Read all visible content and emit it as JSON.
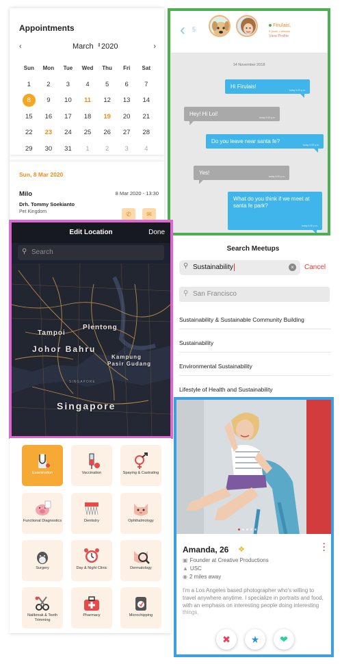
{
  "appointments": {
    "title": "Appointments",
    "month": "March",
    "year": "2020",
    "prev_icon": "chevron-left",
    "next_icon": "chevron-right",
    "weekdays": [
      "Sun",
      "Mon",
      "Tue",
      "Wed",
      "Thu",
      "Fri",
      "Sat"
    ],
    "weeks": [
      [
        "1",
        "2",
        "3",
        "4",
        "5",
        "6",
        "7"
      ],
      [
        "8",
        "9",
        "10",
        "11",
        "12",
        "13",
        "14"
      ],
      [
        "15",
        "16",
        "17",
        "18",
        "19",
        "20",
        "21"
      ],
      [
        "22",
        "23",
        "24",
        "25",
        "26",
        "27",
        "28"
      ],
      [
        "29",
        "30",
        "31",
        "1",
        "2",
        "3",
        "4"
      ]
    ],
    "selected_day": "8",
    "highlighted_days": [
      "11",
      "19",
      "23"
    ],
    "appointment": {
      "date": "Sun, 8 Mar 2020",
      "name": "Milo",
      "time": "8 Mar 2020 - 13:30",
      "doctor": "Drh. Tommy Soekianto",
      "place": "Pet Kingdom"
    },
    "accent_color": "#f5a623"
  },
  "chat": {
    "back_count": "5",
    "contact_name": "Firulais,",
    "contact_sub": "5 years, Labrador",
    "view_profile": "View Profile",
    "date": "14 November 2018",
    "timestamp": "today 9:00 p.m.",
    "messages": [
      {
        "dir": "out",
        "text": "Hi Firulais!"
      },
      {
        "dir": "in",
        "text": "Hey! Hi Loi!"
      },
      {
        "dir": "out",
        "text": "Do you leave near santa fe?"
      },
      {
        "dir": "in",
        "text": "Yes!"
      },
      {
        "dir": "out",
        "text": "What do you think if we meet at santa fe park?"
      }
    ],
    "out_color": "#3fb5ec",
    "in_color": "#a9a9a9"
  },
  "meetups": {
    "title": "Search Meetups",
    "query": "Sustainability",
    "cancel": "Cancel",
    "location": "San Francisco",
    "results": [
      "Sustainability & Sustainable Community Building",
      "Sustainability",
      "Environmental Sustainability",
      "Lifestyle of Health and Sustainability"
    ]
  },
  "map": {
    "title": "Edit Location",
    "done": "Done",
    "search_placeholder": "Search",
    "labels": {
      "tampoi": "Tampoi",
      "plentong": "Plentong",
      "johor_bahru": "Johor Bahru",
      "kampung": "Kampung",
      "pasir_gudang": "Pasir Gudang",
      "singapore_small": "SINGAPORE",
      "singapore": "Singapore"
    }
  },
  "services": {
    "items": [
      {
        "label": "Examination",
        "icon": "stethoscope-icon",
        "active": true
      },
      {
        "label": "Vaccination",
        "icon": "syringe-icon",
        "active": false
      },
      {
        "label": "Spaying & Castrating",
        "icon": "gender-icon",
        "active": false
      },
      {
        "label": "Functional Diagnostics",
        "icon": "pig-icon",
        "active": false
      },
      {
        "label": "Dentistry",
        "icon": "teeth-icon",
        "active": false
      },
      {
        "label": "Ophthalmology",
        "icon": "cat-face-icon",
        "active": false
      },
      {
        "label": "Surgery",
        "icon": "dog-icon",
        "active": false
      },
      {
        "label": "Day & Night Clinic",
        "icon": "alarm-clock-icon",
        "active": false
      },
      {
        "label": "Dermatology",
        "icon": "magnifier-icon",
        "active": false
      },
      {
        "label": "Nailbreak & Teeth Trimming",
        "icon": "scissors-icon",
        "active": false
      },
      {
        "label": "Pharmacy",
        "icon": "medkit-icon",
        "active": false
      },
      {
        "label": "Microchipping",
        "icon": "chip-icon",
        "active": false
      }
    ]
  },
  "profile": {
    "name": "Amanda, 26",
    "job": "Founder at Creative Productions",
    "school": "USC",
    "distance": "2 miles away",
    "bio": "I'm a Los Angeles based photographer who's willing to travel anywhere anytime. I specialize in portraits and food, with an emphasis on interesting people doing interesting things.",
    "actions": [
      "close-icon",
      "star-icon",
      "heart-icon"
    ]
  }
}
